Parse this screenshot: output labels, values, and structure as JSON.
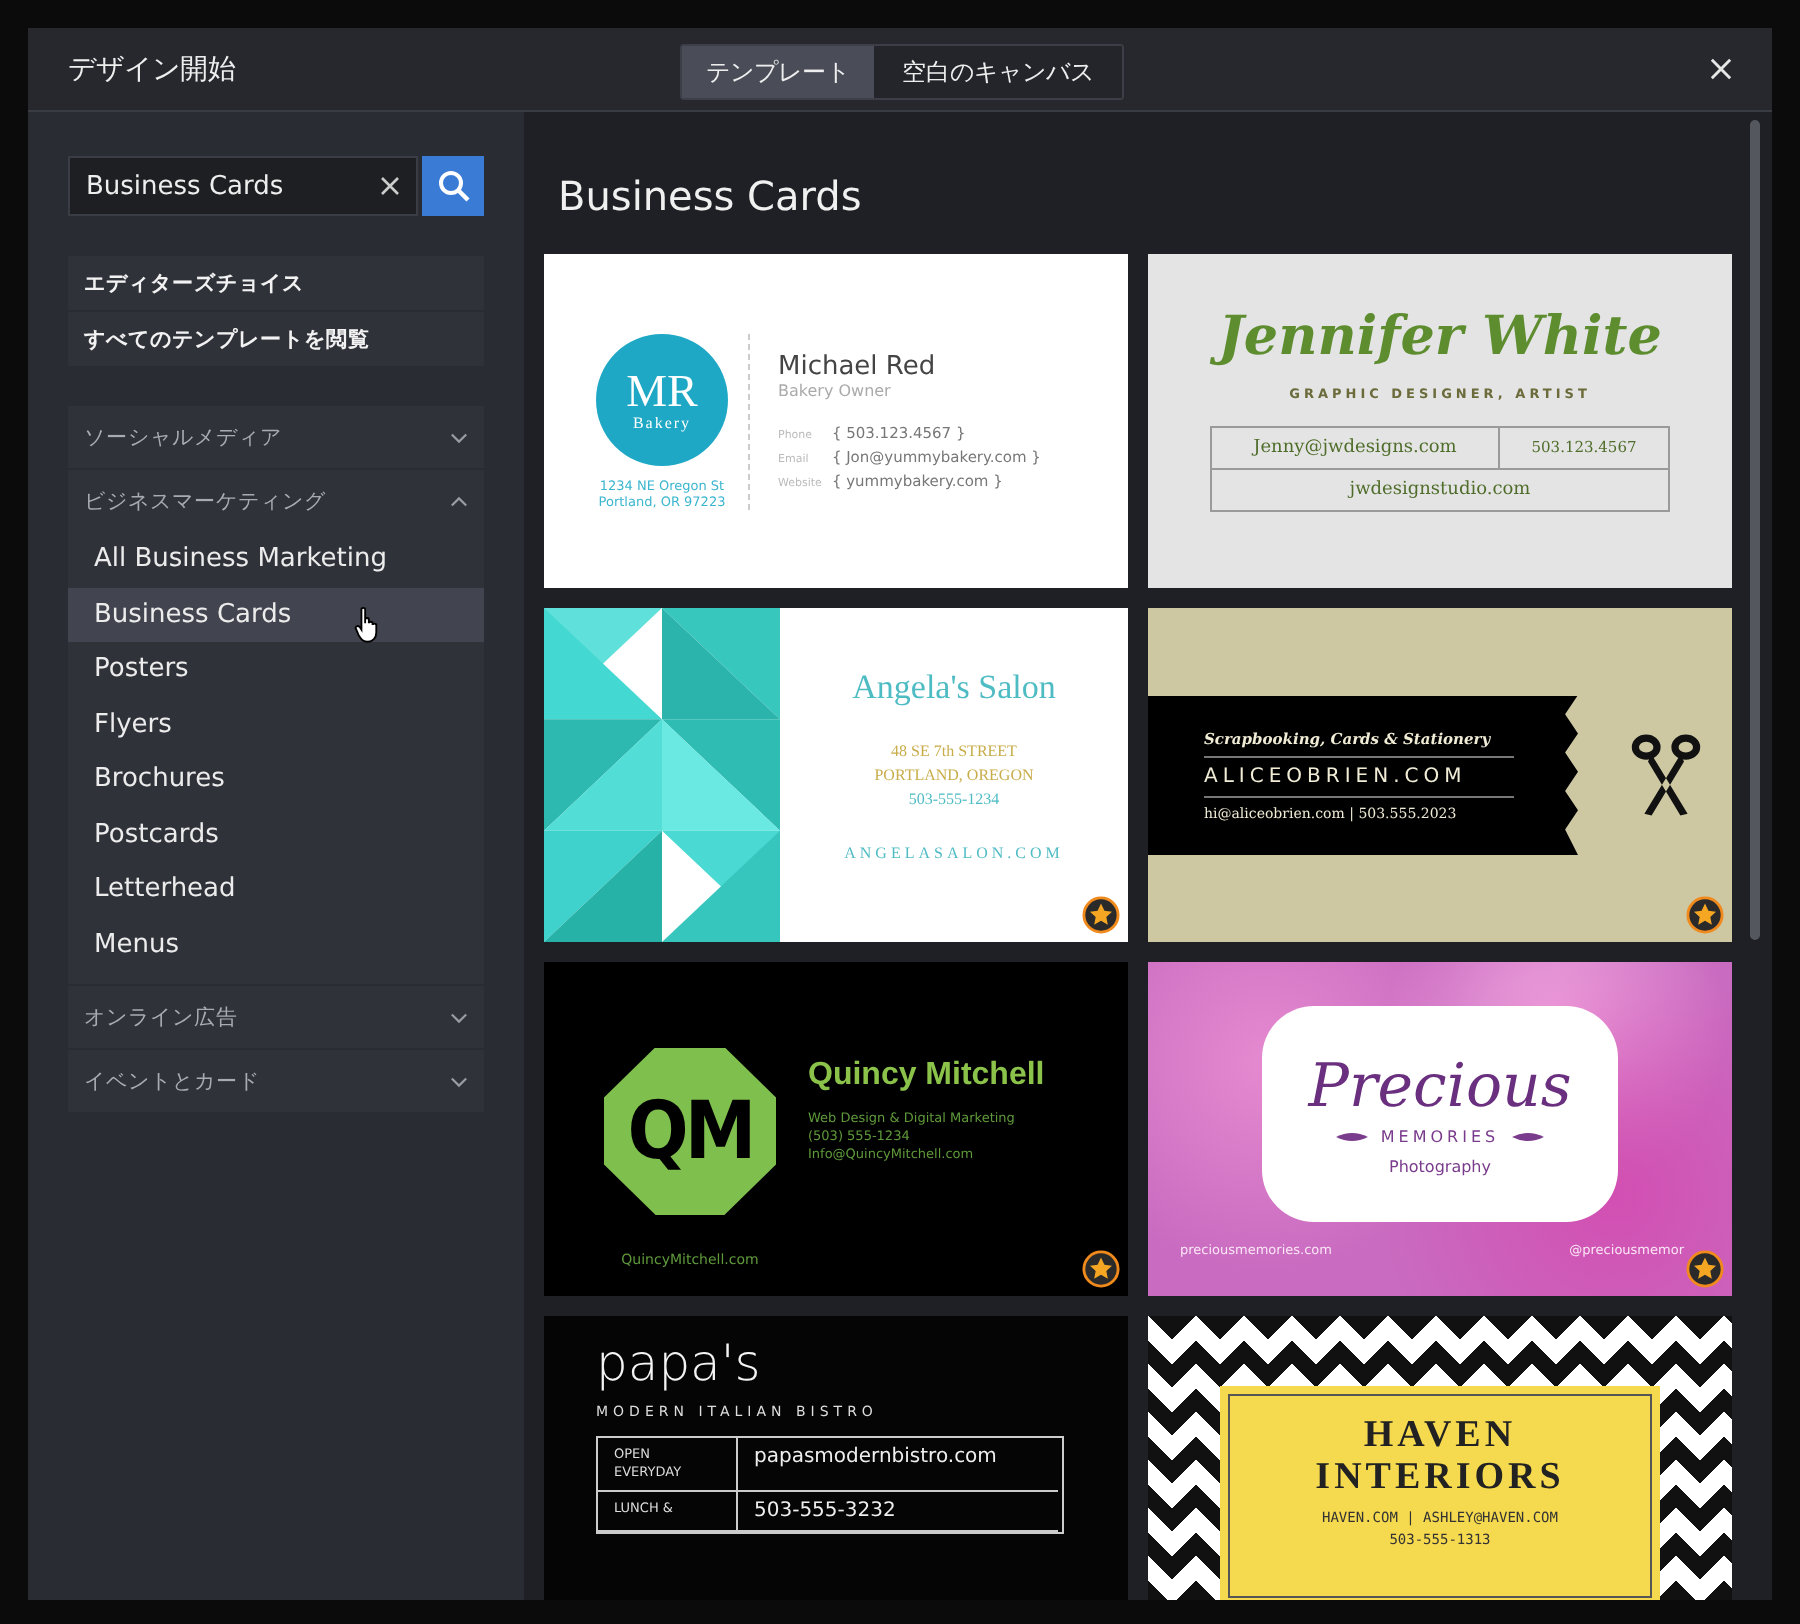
{
  "dialog": {
    "title": "デザイン開始",
    "tabs": [
      {
        "label": "テンプレート",
        "selected": true
      },
      {
        "label": "空白のキャンバス",
        "selected": false
      }
    ]
  },
  "sidebar": {
    "search": {
      "value": "Business Cards"
    },
    "top_links": [
      "エディターズチョイス",
      "すべてのテンプレートを閲覧"
    ],
    "categories": [
      {
        "label": "ソーシャルメディア",
        "expanded": false
      },
      {
        "label": "ビジネスマーケティング",
        "expanded": true,
        "children": [
          {
            "label": "All Business Marketing",
            "selected": false
          },
          {
            "label": "Business Cards",
            "selected": true
          },
          {
            "label": "Posters",
            "selected": false
          },
          {
            "label": "Flyers",
            "selected": false
          },
          {
            "label": "Brochures",
            "selected": false
          },
          {
            "label": "Postcards",
            "selected": false
          },
          {
            "label": "Letterhead",
            "selected": false
          },
          {
            "label": "Menus",
            "selected": false
          }
        ]
      },
      {
        "label": "オンライン広告",
        "expanded": false
      },
      {
        "label": "イベントとカード",
        "expanded": false
      }
    ]
  },
  "content": {
    "heading": "Business Cards",
    "templates": [
      {
        "kind": "monogram",
        "premium": false,
        "logo": "MR",
        "logo_sub": "Bakery",
        "address": [
          "1234 NE Oregon St",
          "Portland, OR 97223"
        ],
        "name": "Michael Red",
        "role": "Bakery Owner",
        "contacts": [
          {
            "label": "Phone",
            "value": "{ 503.123.4567 }"
          },
          {
            "label": "Email",
            "value": "{ Jon@yummybakery.com }"
          },
          {
            "label": "Website",
            "value": "{ yummybakery.com }"
          }
        ]
      },
      {
        "kind": "script",
        "premium": false,
        "name": "Jennifer White",
        "role": "GRAPHIC DESIGNER, ARTIST",
        "cells": [
          "Jenny@jwdesigns.com",
          "503.123.4567",
          "jwdesignstudio.com"
        ]
      },
      {
        "kind": "salon",
        "premium": true,
        "name": "Angela's Salon",
        "address": [
          "48 SE 7th STREET",
          "PORTLAND, OREGON"
        ],
        "phone": "503-555-1234",
        "website": "ANGELASALON.COM"
      },
      {
        "kind": "ribbon",
        "premium": true,
        "tagline": "Scrapbooking, Cards & Stationery",
        "site": "ALICEOBRIEN.COM",
        "contact": "hi@aliceobrien.com | 503.555.2023"
      },
      {
        "kind": "octagon",
        "premium": true,
        "logo": "QM",
        "name": "Quincy Mitchell",
        "lines": [
          "Web Design & Digital Marketing",
          "(503) 555-1234",
          "Info@QuincyMitchell.com"
        ],
        "website": "QuincyMitchell.com"
      },
      {
        "kind": "frame",
        "premium": true,
        "title": "Precious",
        "subtitle": "MEMORIES",
        "tagline": "Photography",
        "website": "preciousmemories.com",
        "handle": "@preciousmemor"
      },
      {
        "kind": "bistro",
        "name": "papa's",
        "subtitle": "MODERN ITALIAN BISTRO",
        "rows": [
          {
            "label": "OPEN EVERYDAY",
            "value": "papasmodernbistro.com"
          },
          {
            "label": "LUNCH &",
            "value": "503-555-3232"
          }
        ]
      },
      {
        "kind": "chevron",
        "title": [
          "HAVEN",
          "INTERIORS"
        ],
        "contact": "HAVEN.COM | ASHLEY@HAVEN.COM",
        "phone": "503-555-1313"
      }
    ]
  }
}
